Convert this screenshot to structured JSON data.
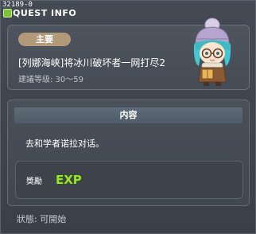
{
  "window": {
    "quest_id": "32189-0",
    "title": "QUEST INFO"
  },
  "quest": {
    "category_tag": "主要",
    "name": "[列娜海峡]将冰川破坏者一网打尽2",
    "recommended_level": "建議等级: 30～59",
    "npc_icon": "scholar-girl-npc-portrait"
  },
  "content": {
    "header": "内容",
    "description": "去和学者诺拉对话。",
    "reward_label": "獎勵",
    "reward_icon": "exp-icon",
    "reward_icon_text": "EXP"
  },
  "footer": {
    "status": "狀態:  可開始"
  },
  "colors": {
    "tag_bg": "#b29a79",
    "exp_fill": "#9be22c",
    "title_icon": "#7ec23a"
  }
}
